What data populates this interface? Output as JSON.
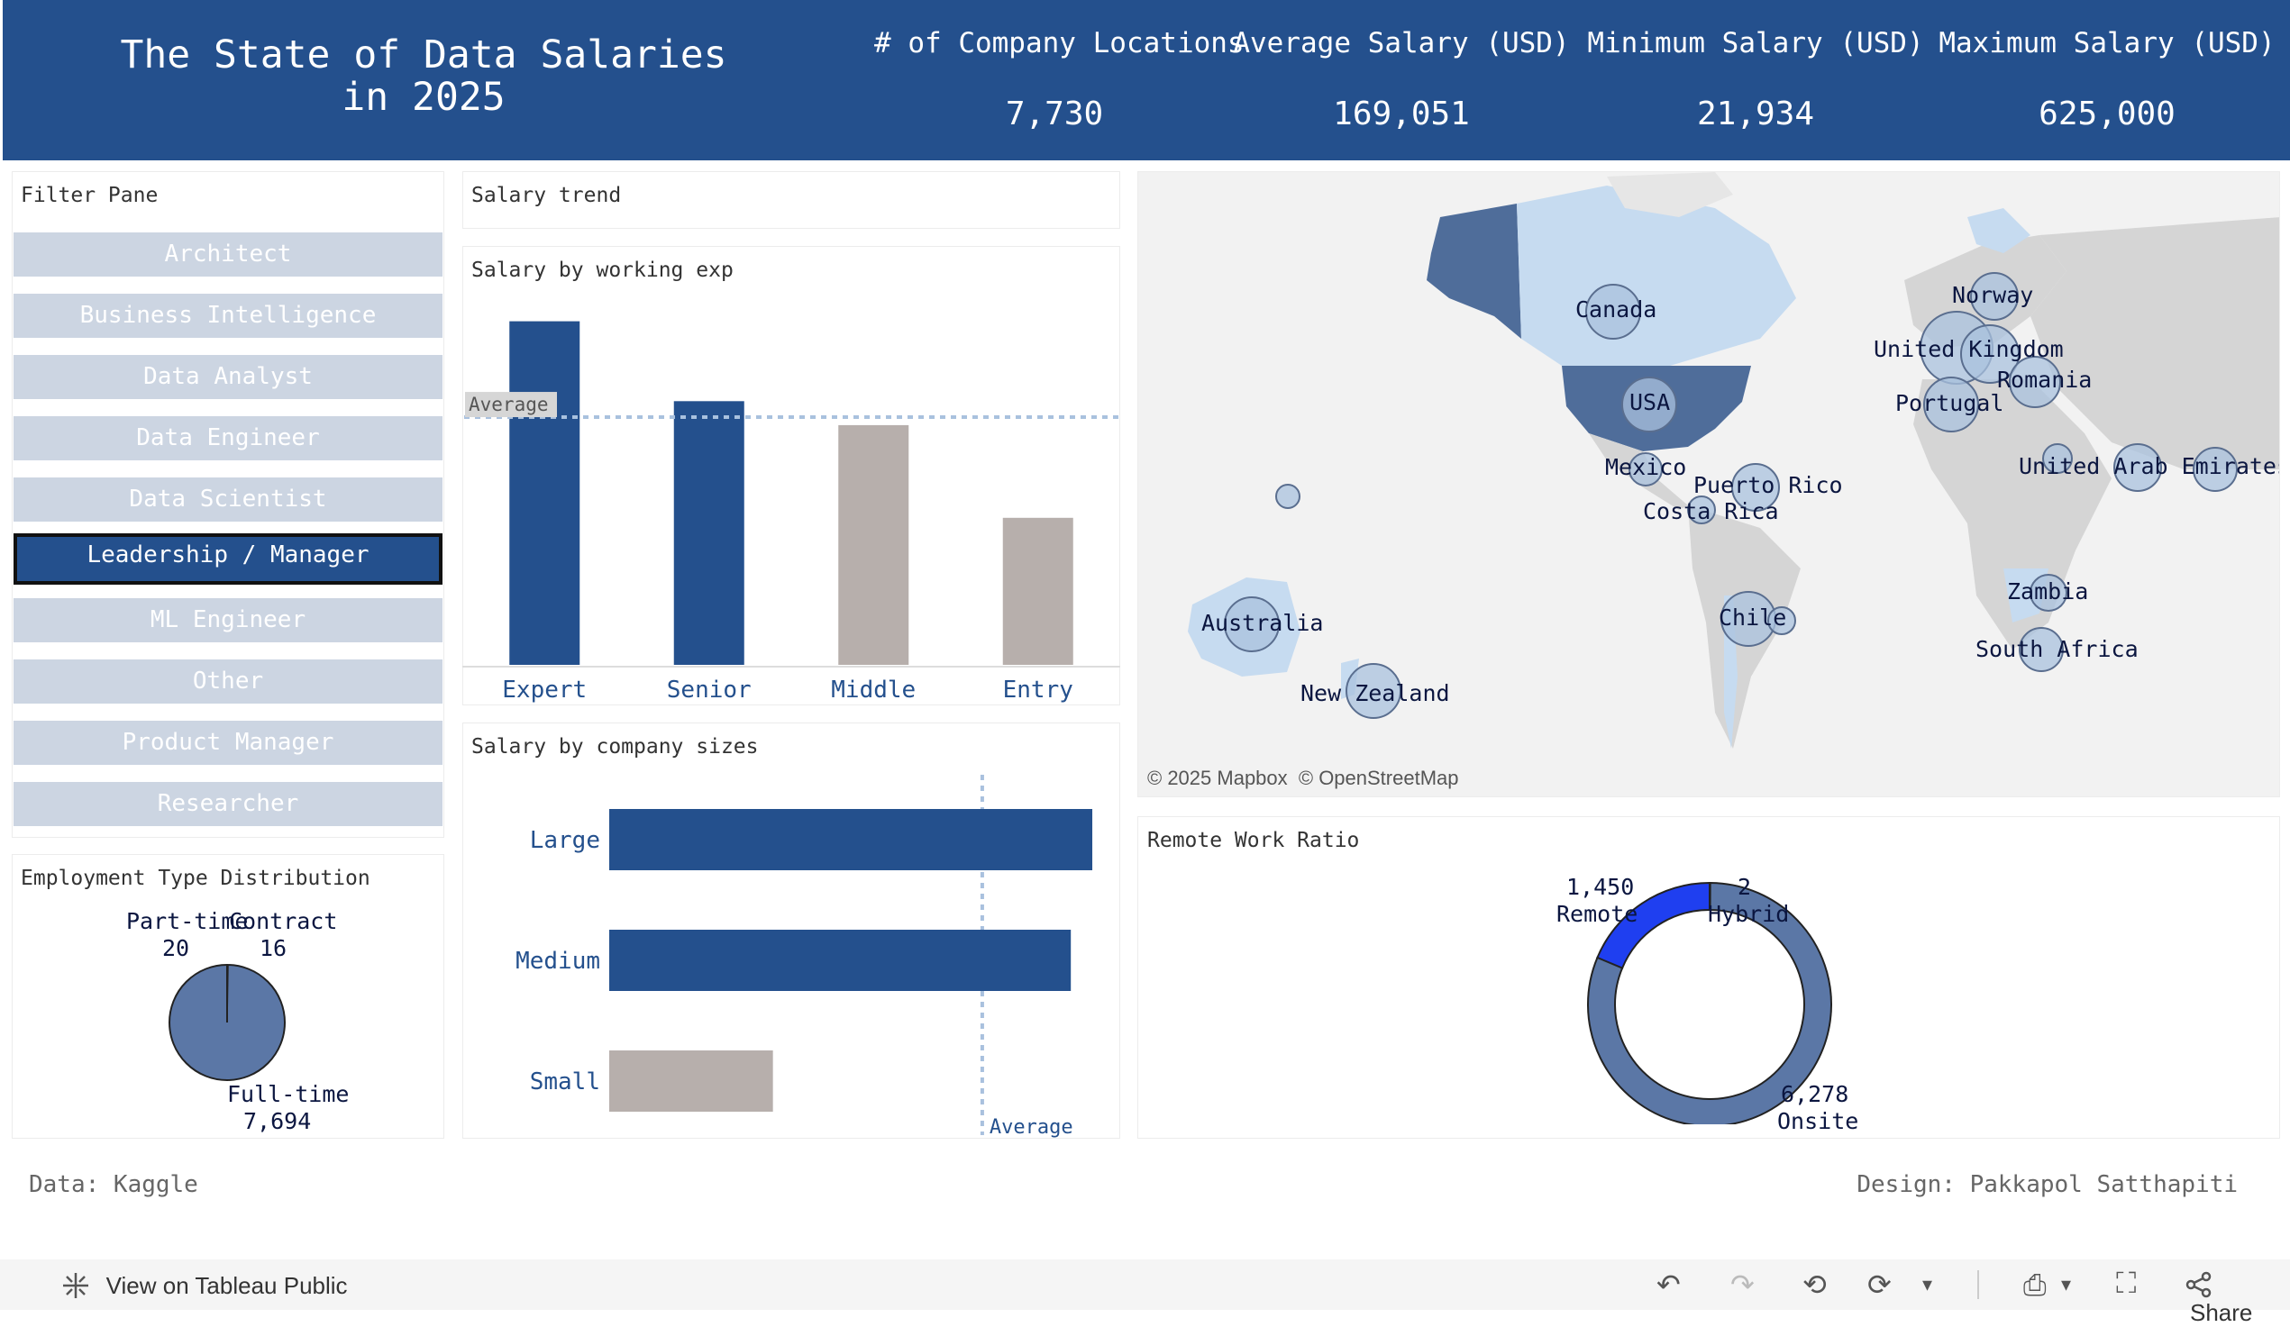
{
  "header": {
    "title": "The State of Data Salaries\nin 2025",
    "kpis": [
      {
        "label": "# of Company Locations",
        "value": "7,730"
      },
      {
        "label": "Average Salary (USD)",
        "value": "169,051"
      },
      {
        "label": "Minimum Salary (USD)",
        "value": "21,934"
      },
      {
        "label": "Maximum Salary (USD)",
        "value": "625,000"
      }
    ]
  },
  "filter_pane": {
    "title": "Filter Pane",
    "items": [
      "Architect",
      "Business Intelligence",
      "Data Analyst",
      "Data Engineer",
      "Data Scientist",
      "Leadership / Manager",
      "ML Engineer",
      "Other",
      "Product Manager",
      "Researcher"
    ],
    "selected": "Leadership / Manager"
  },
  "employment": {
    "title": "Employment Type Distribution",
    "part_time_label": "Part-time",
    "part_time_value": "20",
    "contract_label": "Contract",
    "contract_value": "16",
    "full_time_label": "Full-time",
    "full_time_value": "7,694"
  },
  "salary_trend": {
    "title": "Salary trend"
  },
  "exp_chart": {
    "title": "Salary by working exp",
    "average_label": "Average",
    "chart_data": {
      "type": "bar",
      "categories": [
        "Expert",
        "Senior",
        "Middle",
        "Entry"
      ],
      "values": [
        215000,
        165000,
        150000,
        92000
      ],
      "highlighted": [
        true,
        true,
        false,
        false
      ],
      "average": 155000,
      "ylim": [
        0,
        230000
      ]
    }
  },
  "size_chart": {
    "title": "Salary by company sizes",
    "average_label": "Average",
    "chart_data": {
      "type": "bar",
      "orientation": "horizontal",
      "categories": [
        "Large",
        "Medium",
        "Small"
      ],
      "values": [
        180000,
        172000,
        61000
      ],
      "highlighted": [
        true,
        true,
        false
      ],
      "average": 139000,
      "xlim": [
        0,
        181000
      ]
    }
  },
  "map": {
    "attribution": "© 2025 Mapbox  © OpenStreetMap",
    "labels": {
      "canada": "Canada",
      "usa": "USA",
      "mexico": "Mexico",
      "puerto_rico": "Puerto Rico",
      "costa_rica": "Costa Rica",
      "norway": "Norway",
      "uk": "United Kingdom",
      "romania": "Romania",
      "portugal": "Portugal",
      "uae": "United Arab Emirates",
      "australia": "Australia",
      "new_zealand": "New Zealand",
      "chile": "Chile",
      "zambia": "Zambia",
      "south_africa": "South Africa"
    }
  },
  "remote": {
    "title": "Remote Work Ratio",
    "remote_value": "1,450",
    "remote_label": "Remote",
    "hybrid_value": "2",
    "hybrid_label": "Hybrid",
    "onsite_value": "6,278",
    "onsite_label": "Onsite",
    "chart_data": {
      "type": "pie",
      "categories": [
        "Remote",
        "Hybrid",
        "Onsite"
      ],
      "values": [
        1450,
        2,
        6278
      ]
    }
  },
  "footer": {
    "data_source": "Data: Kaggle",
    "design": "Design: Pakkapol Satthapiti"
  },
  "toolbar": {
    "view_label": "View on Tableau Public",
    "share_label": "Share"
  },
  "colors": {
    "primary": "#24508d",
    "muted_bar": "#b7afac",
    "remote": "#1f3ff0",
    "onsite": "#5b77a6",
    "filter_idle": "#ccd5e2"
  }
}
